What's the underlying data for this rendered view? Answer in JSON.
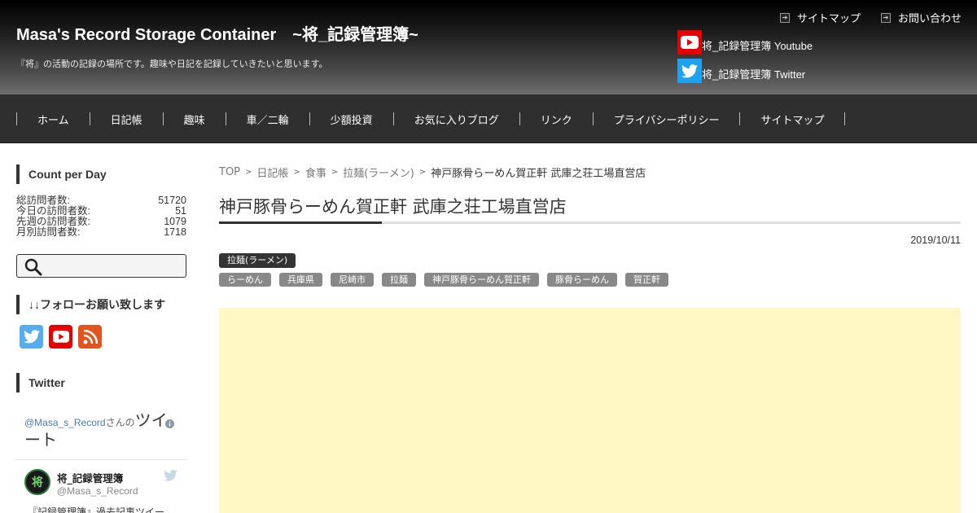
{
  "header": {
    "title": "Masa's Record Storage Container　~将_記録管理簿~",
    "description": "『将』の活動の記録の場所です。趣味や日記を記録していきたいと思います。",
    "top_links": [
      "サイトマップ",
      "お問い合わせ"
    ],
    "sns": [
      {
        "icon": "youtube-icon",
        "label": "将_記録管理簿 Youtube",
        "color": "#e60000"
      },
      {
        "icon": "twitter-icon",
        "label": "将_記録管理簿 Twitter",
        "color": "#1da1f2"
      }
    ]
  },
  "nav": {
    "items": [
      "ホーム",
      "日記帳",
      "趣味",
      "車／二輪",
      "少額投資",
      "お気に入りブログ",
      "リンク",
      "プライバシーポリシー",
      "サイトマップ"
    ]
  },
  "sidebar": {
    "count_title": "Count per Day",
    "counts": [
      {
        "label": "総訪問者数:",
        "value": "51720"
      },
      {
        "label": "今日の訪問者数:",
        "value": "51"
      },
      {
        "label": "先週の訪問者数:",
        "value": "1079"
      },
      {
        "label": "月別訪問者数:",
        "value": "1718"
      }
    ],
    "follow_title": "↓↓フォローお願い致します",
    "follow_icons": [
      "twitter-icon",
      "youtube-icon",
      "rss-icon"
    ],
    "twitter_title": "Twitter",
    "twitter_widget": {
      "handle_link": "@Masa_s_Record",
      "san": "さんの",
      "tweet_word": "ツイート",
      "author_name": "将_記録管理簿",
      "author_handle": "@Masa_s_Record",
      "avatar_char": "将",
      "snippet": "『記録管理簿』過去記事ツイー"
    }
  },
  "main": {
    "breadcrumb": [
      "TOP",
      "日記帳",
      "食事",
      "拉麺(ラーメン)"
    ],
    "breadcrumb_current": "神戸豚骨らーめん賀正軒 武庫之荘工場直営店",
    "title": "神戸豚骨らーめん賀正軒 武庫之荘工場直営店",
    "date": "2019/10/11",
    "category": "拉麺(ラーメン)",
    "tags": [
      "らーめん",
      "兵庫県",
      "尼崎市",
      "拉麺",
      "神戸豚骨らーめん賀正軒",
      "豚骨らーめん",
      "賀正軒"
    ]
  },
  "colors": {
    "header_dark": "#000000",
    "nav_bg": "#2f2f2f",
    "ad_bg": "#fff8c4",
    "tag_bg": "#888888"
  }
}
